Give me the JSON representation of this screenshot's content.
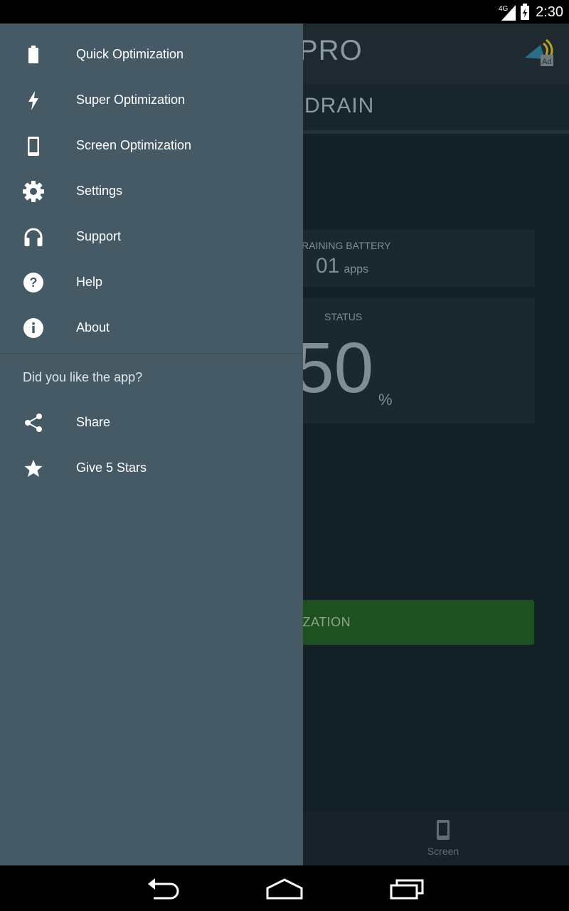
{
  "status_bar": {
    "network": "4G",
    "time": "2:30"
  },
  "background_app": {
    "title": "PRO",
    "tab_title": "DRAIN",
    "draining_card": {
      "label": "RAINING BATTERY",
      "value": "01",
      "unit": "apps"
    },
    "status_card": {
      "label": "STATUS",
      "value": "50",
      "unit": "%"
    },
    "action_button": "IZATION",
    "bottom_nav": {
      "screen_label": "Screen"
    }
  },
  "drawer": {
    "items": [
      {
        "label": "Quick Optimization",
        "icon": "battery-icon"
      },
      {
        "label": "Super Optimization",
        "icon": "bolt-icon"
      },
      {
        "label": "Screen Optimization",
        "icon": "phone-icon"
      },
      {
        "label": "Settings",
        "icon": "gear-icon"
      },
      {
        "label": "Support",
        "icon": "headset-icon"
      },
      {
        "label": "Help",
        "icon": "help-icon"
      },
      {
        "label": "About",
        "icon": "info-icon"
      }
    ],
    "feedback_title": "Did you like the app?",
    "feedback_items": [
      {
        "label": "Share",
        "icon": "share-icon"
      },
      {
        "label": "Give 5 Stars",
        "icon": "star-icon"
      }
    ]
  },
  "colors": {
    "drawer_bg": "#455a64",
    "app_bg": "#132026",
    "accent_green": "#1f5022"
  }
}
